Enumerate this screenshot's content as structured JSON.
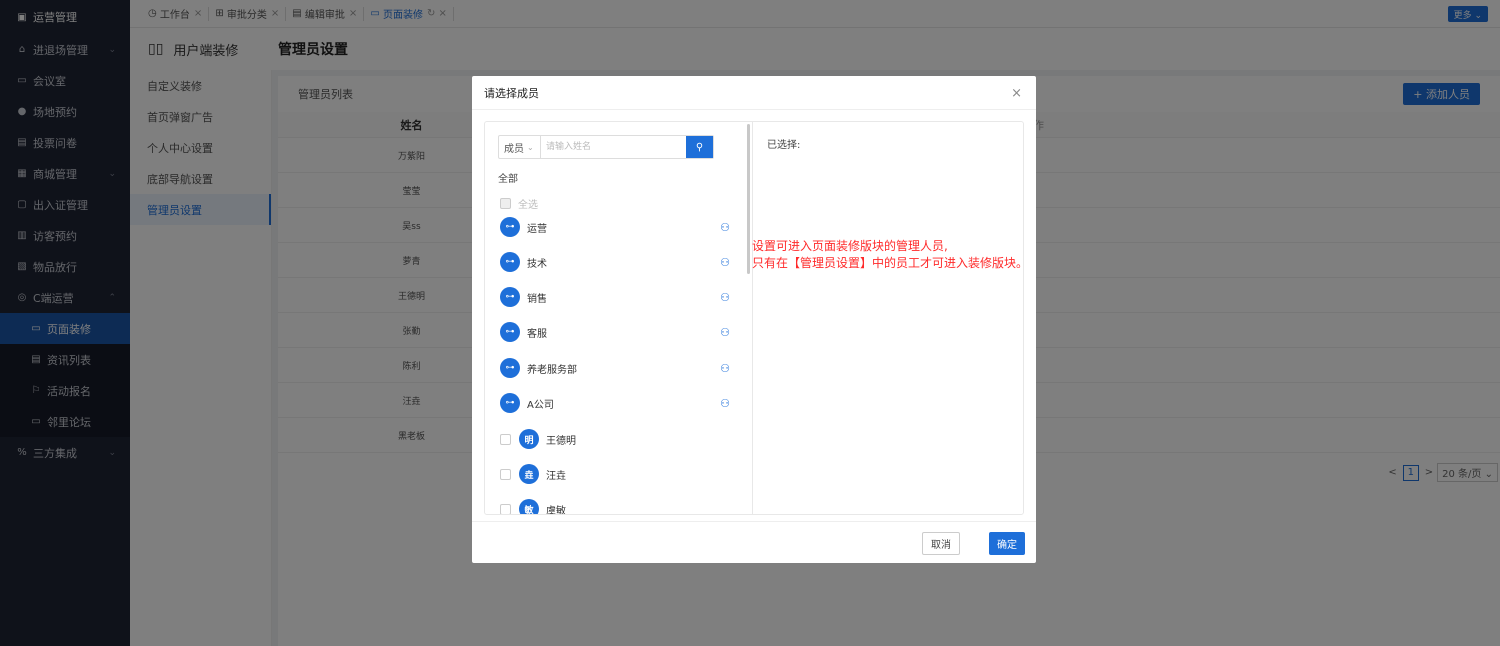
{
  "sidebar": {
    "header": {
      "icon": "▣",
      "label": "运营管理"
    },
    "items": [
      {
        "icon": "⌂",
        "label": "进退场管理",
        "chevron": "⌄"
      },
      {
        "icon": "▭",
        "label": "会议室"
      },
      {
        "icon": "●",
        "label": "场地预约"
      },
      {
        "icon": "▤",
        "label": "投票问卷"
      },
      {
        "icon": "▦",
        "label": "商城管理",
        "chevron": "⌄"
      },
      {
        "icon": "▢",
        "label": "出入证管理"
      },
      {
        "icon": "▥",
        "label": "访客预约"
      },
      {
        "icon": "▧",
        "label": "物品放行"
      },
      {
        "icon": "◎",
        "label": "C端运营",
        "chevron": "⌃"
      }
    ],
    "subitems": [
      {
        "icon": "▭",
        "label": "页面装修",
        "active": true
      },
      {
        "icon": "▤",
        "label": "资讯列表"
      },
      {
        "icon": "⚐",
        "label": "活动报名"
      },
      {
        "icon": "▭",
        "label": "邻里论坛"
      }
    ],
    "footer": {
      "icon": "%",
      "label": "三方集成",
      "chevron": "⌄"
    }
  },
  "tabs": [
    {
      "icon": "◷",
      "label": "工作台",
      "close": "×"
    },
    {
      "icon": "⊞",
      "label": "审批分类",
      "close": "×"
    },
    {
      "icon": "▤",
      "label": "编辑审批",
      "close": "×"
    },
    {
      "icon": "▭",
      "label": "页面装修",
      "close": "↻ ×",
      "active": true
    }
  ],
  "more_button": "更多 ⌄",
  "page_header": {
    "section_icon": "▯▯",
    "section": "用户端装修",
    "title": "管理员设置"
  },
  "submenu": [
    "自定义装修",
    "首页弹窗广告",
    "个人中心设置",
    "底部导航设置",
    "管理员设置"
  ],
  "main": {
    "list_title": "管理员列表",
    "add_button": "+ 添加人员",
    "columns": {
      "name": "姓名",
      "op": "作"
    },
    "rows": [
      "万紫阳",
      "莹莹",
      "吴ss",
      "萝青",
      "王德明",
      "张勤",
      "陈利",
      "汪垚",
      "黑老板"
    ],
    "pager": {
      "prev": "<",
      "page": "1",
      "next": ">",
      "size": "20 条/页 ⌄"
    }
  },
  "dialog": {
    "title": "请选择成员",
    "close": "×",
    "search": {
      "type": "成员",
      "type_arrow": "⌄",
      "placeholder": "请输入姓名",
      "button_icon": "⚲"
    },
    "all_label": "全部",
    "select_all": "全选",
    "departments": [
      {
        "name": "运营",
        "avatar": "⊶",
        "tree": "⚇"
      },
      {
        "name": "技术",
        "avatar": "⊶",
        "tree": "⚇"
      },
      {
        "name": "销售",
        "avatar": "⊶",
        "tree": "⚇"
      },
      {
        "name": "客服",
        "avatar": "⊶",
        "tree": "⚇"
      },
      {
        "name": "养老服务部",
        "avatar": "⊶",
        "tree": "⚇"
      },
      {
        "name": "A公司",
        "avatar": "⊶",
        "tree": "⚇"
      }
    ],
    "members": [
      {
        "avatar": "明",
        "name": "王德明"
      },
      {
        "avatar": "垚",
        "name": "汪垚"
      },
      {
        "avatar": "敏",
        "name": "虞敏"
      }
    ],
    "selected_label": "已选择:",
    "cancel": "取消",
    "ok": "确定"
  },
  "annotation": {
    "line1": "设置可进入页面装修版块的管理人员,",
    "line2": "只有在【管理员设置】中的员工才可进入装修版块。"
  }
}
